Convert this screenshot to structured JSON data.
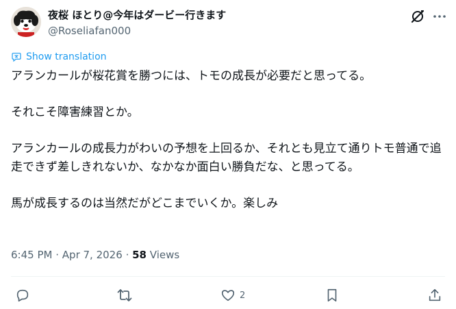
{
  "user": {
    "display_name": "夜桜 ほとり@今年はダービー行きます",
    "handle": "@Roseliafan000"
  },
  "header": {
    "grok_icon": "grok-icon",
    "more_icon": "more-horizontal-icon"
  },
  "translation": {
    "label": "Show translation"
  },
  "tweet": {
    "paragraphs": [
      "アランカールが桜花賞を勝つには、トモの成長が必要だと思ってる。",
      "それこそ障害練習とか。",
      "アランカールの成長力がわいの予想を上回るか、それとも見立て通りトモ普通で追走できず差しきれないか、なかなか面白い勝負だな、と思ってる。",
      "馬が成長するのは当然だがどこまでいくか。楽しみ"
    ]
  },
  "meta": {
    "time": "6:45 PM",
    "separator1": "·",
    "date": "Apr 7, 2026",
    "separator2": "·",
    "views_count": "58",
    "views_label": "Views"
  },
  "actions": {
    "reply_icon": "reply-icon",
    "repost_icon": "repost-icon",
    "like_icon": "heart-icon",
    "like_count": "2",
    "bookmark_icon": "bookmark-icon",
    "share_icon": "share-icon"
  },
  "colors": {
    "accent": "#1d9bf0",
    "text": "#0f1419",
    "secondary": "#536471",
    "divider": "#eff3f4"
  }
}
